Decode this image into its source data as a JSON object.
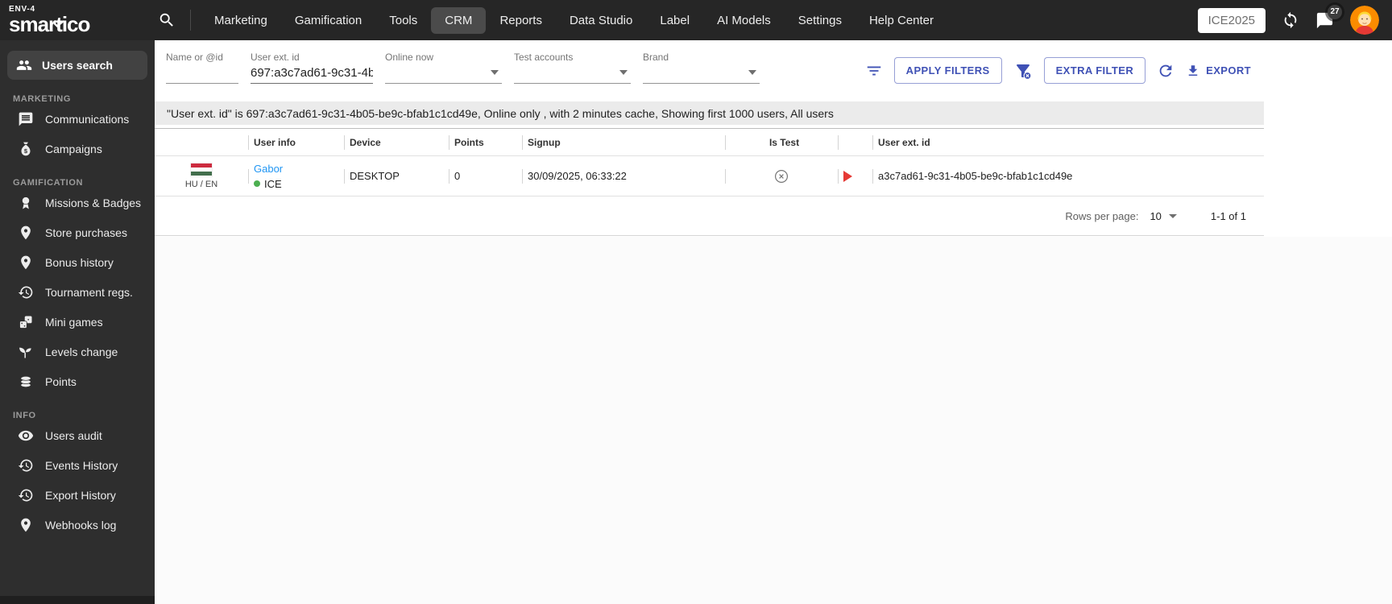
{
  "topbar": {
    "env_label": "ENV-4",
    "logo": "smartico",
    "nav": [
      {
        "label": "Marketing"
      },
      {
        "label": "Gamification"
      },
      {
        "label": "Tools"
      },
      {
        "label": "CRM"
      },
      {
        "label": "Reports"
      },
      {
        "label": "Data Studio"
      },
      {
        "label": "Label"
      },
      {
        "label": "AI Models"
      },
      {
        "label": "Settings"
      },
      {
        "label": "Help Center"
      }
    ],
    "active_nav": "CRM",
    "brand_box": "ICE2025",
    "notification_count": "27"
  },
  "sidebar": {
    "search_label": "Users search",
    "sections": [
      {
        "title": "MARKETING",
        "items": [
          {
            "label": "Communications",
            "icon": "communications-icon"
          },
          {
            "label": "Campaigns",
            "icon": "money-bag-icon"
          }
        ]
      },
      {
        "title": "GAMIFICATION",
        "items": [
          {
            "label": "Missions & Badges",
            "icon": "badge-icon"
          },
          {
            "label": "Store purchases",
            "icon": "pin-icon"
          },
          {
            "label": "Bonus history",
            "icon": "pin-icon"
          },
          {
            "label": "Tournament regs.",
            "icon": "history-icon"
          },
          {
            "label": "Mini games",
            "icon": "dice-icon"
          },
          {
            "label": "Levels change",
            "icon": "seedling-icon"
          },
          {
            "label": "Points",
            "icon": "coins-icon"
          }
        ]
      },
      {
        "title": "INFO",
        "items": [
          {
            "label": "Users audit",
            "icon": "eye-icon"
          },
          {
            "label": "Events History",
            "icon": "history-icon"
          },
          {
            "label": "Export History",
            "icon": "history-icon"
          },
          {
            "label": "Webhooks log",
            "icon": "pin-icon"
          }
        ]
      }
    ]
  },
  "filters": {
    "fields": [
      {
        "label": "Name or @id",
        "value": "",
        "type": "text"
      },
      {
        "label": "User ext. id",
        "value": "697:a3c7ad61-9c31-4b",
        "type": "text"
      },
      {
        "label": "Online now",
        "value": "",
        "type": "select"
      },
      {
        "label": "Test accounts",
        "value": "",
        "type": "select"
      },
      {
        "label": "Brand",
        "value": "",
        "type": "select"
      }
    ],
    "apply_label": "APPLY FILTERS",
    "extra_label": "EXTRA FILTER",
    "export_label": "EXPORT"
  },
  "summary_bar": {
    "text": "\"User ext. id\" is 697:a3c7ad61-9c31-4b05-be9c-bfab1c1cd49e, Online only , with 2 minutes cache, Showing first 1000 users, All users"
  },
  "table": {
    "columns": [
      "User info",
      "Device",
      "Points",
      "Signup",
      "Is Test",
      "User ext. id"
    ],
    "rows": [
      {
        "flag": "HU",
        "lang": "HU / EN",
        "name": "Gabor",
        "brand_tag": "ICE",
        "online": true,
        "device": "DESKTOP",
        "points": "0",
        "signup": "30/09/2025, 06:33:22",
        "is_test": "no",
        "user_ext_id": "a3c7ad61-9c31-4b05-be9c-bfab1c1cd49e"
      }
    ]
  },
  "pagination": {
    "rows_per_page_label": "Rows per page:",
    "rows_per_page": "10",
    "range": "1-1 of 1"
  },
  "colors": {
    "accent": "#3f51b5",
    "link": "#2196f3",
    "online_dot": "#4caf50",
    "play_arrow": "#e53935",
    "topbar_bg": "#262626",
    "sidebar_bg": "#2e2e2e",
    "summary_bg": "#ebebeb"
  }
}
